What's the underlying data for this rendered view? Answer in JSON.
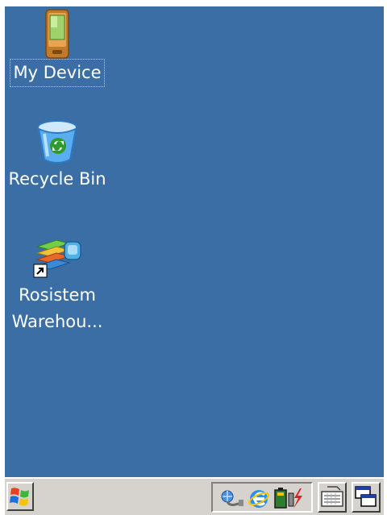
{
  "desktop": {
    "background": "#3a6ea5",
    "icons": [
      {
        "label": "My Device",
        "icon": "pda-device-icon"
      },
      {
        "label": "Recycle Bin",
        "icon": "recycle-bin-icon"
      },
      {
        "label": "Rosistem\nWarehou...",
        "icon": "warehouse-app-shortcut-icon"
      }
    ]
  },
  "taskbar": {
    "start": {
      "icon": "windows-flag-icon"
    },
    "tray": [
      {
        "icon": "network-connection-icon"
      },
      {
        "icon": "internet-explorer-icon"
      },
      {
        "icon": "battery-charging-icon"
      }
    ],
    "keyboard": {
      "icon": "keyboard-icon"
    },
    "desktop_switch": {
      "icon": "windows-switch-icon"
    }
  }
}
